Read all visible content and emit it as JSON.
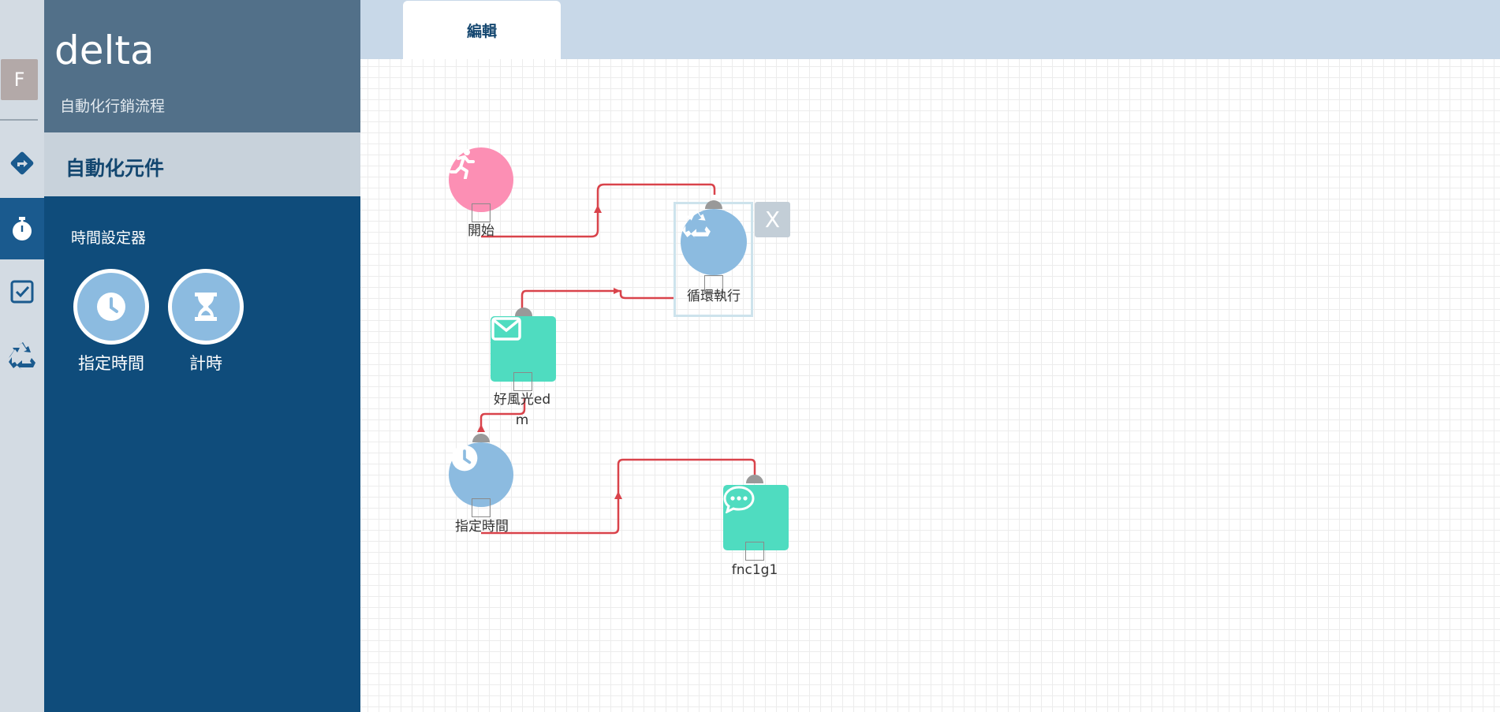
{
  "rail": {
    "avatar_letter": "F",
    "items": [
      {
        "icon": "directions-icon"
      },
      {
        "icon": "stopwatch-icon"
      },
      {
        "icon": "checkbox-icon"
      },
      {
        "icon": "recycle-icon"
      }
    ]
  },
  "panel": {
    "app_title": "delta",
    "app_subtitle": "自動化行銷流程",
    "section_title": "自動化元件",
    "group_label": "時間設定器",
    "components": [
      {
        "label": "指定時間",
        "icon": "clock-icon"
      },
      {
        "label": "計時",
        "icon": "hourglass-icon"
      }
    ]
  },
  "tabs": [
    {
      "label": "編輯"
    }
  ],
  "canvas": {
    "nodes": [
      {
        "id": "start",
        "label": "開始",
        "icon": "running-person-icon",
        "color": "#fc8fb4"
      },
      {
        "id": "loop",
        "label": "循環執行",
        "icon": "recycle-icon",
        "color": "#8cbbe0"
      },
      {
        "id": "edm",
        "label": "好風光edm",
        "icon": "envelope-icon",
        "color": "#4fdcc0"
      },
      {
        "id": "time",
        "label": "指定時間",
        "icon": "clock-icon",
        "color": "#8cbbe0"
      },
      {
        "id": "msg",
        "label": "fnc1g1",
        "icon": "chat-bubble-icon",
        "color": "#4fdcc0"
      }
    ],
    "delete_label": "X"
  },
  "colors": {
    "accent": "#0f4c7b",
    "header": "#527089",
    "connector": "#d9434b",
    "pink": "#fc8fb4",
    "blue": "#8cbbe0",
    "teal": "#4fdcc0"
  }
}
